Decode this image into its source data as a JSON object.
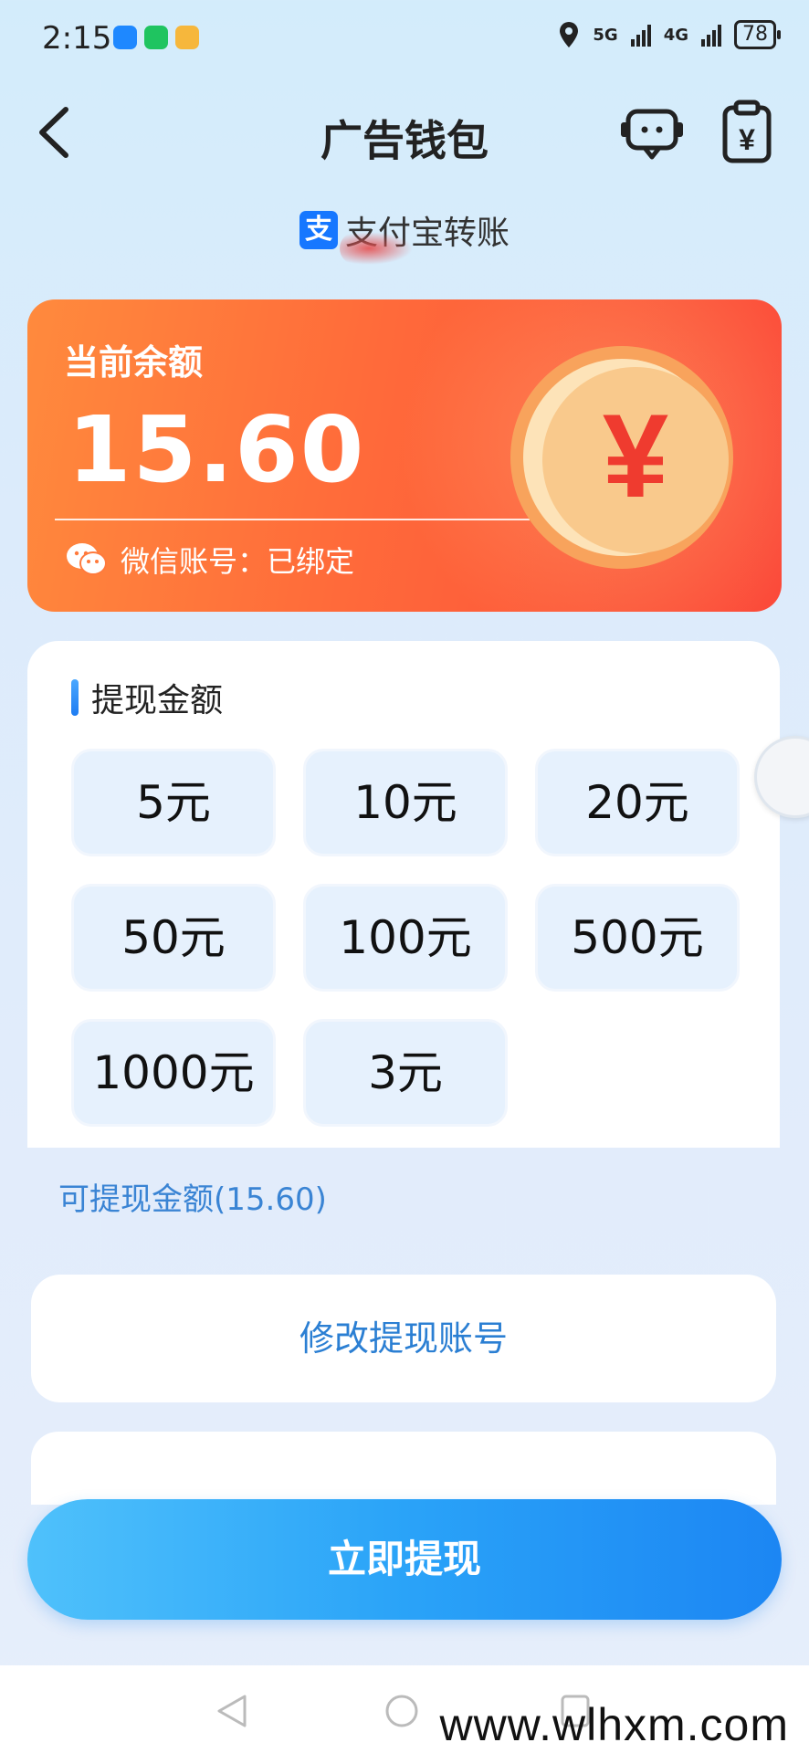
{
  "status_bar": {
    "time": "2:15",
    "net1": "5G",
    "net2": "4G",
    "battery": "78"
  },
  "header": {
    "title": "广告钱包",
    "back_icon": "back-arrow-icon",
    "service_icon": "customer-service-icon",
    "bill_icon": "bill-icon"
  },
  "pay_method": {
    "icon_char": "支",
    "label": "支付宝转账"
  },
  "balance_card": {
    "label": "当前余额",
    "amount": "15.60",
    "wechat_text": "微信账号：已绑定",
    "coin_symbol": "¥",
    "colors": {
      "start": "#ff8a3d",
      "end": "#fb4a3a"
    }
  },
  "withdraw": {
    "title": "提现金额",
    "options": [
      "5元",
      "10元",
      "20元",
      "50元",
      "100元",
      "500元",
      "1000元",
      "3元"
    ],
    "available": "可提现金额(15.60)"
  },
  "modify_account": "修改提现账号",
  "cta": "立即提现",
  "watermark": "www.wlhxm.com"
}
